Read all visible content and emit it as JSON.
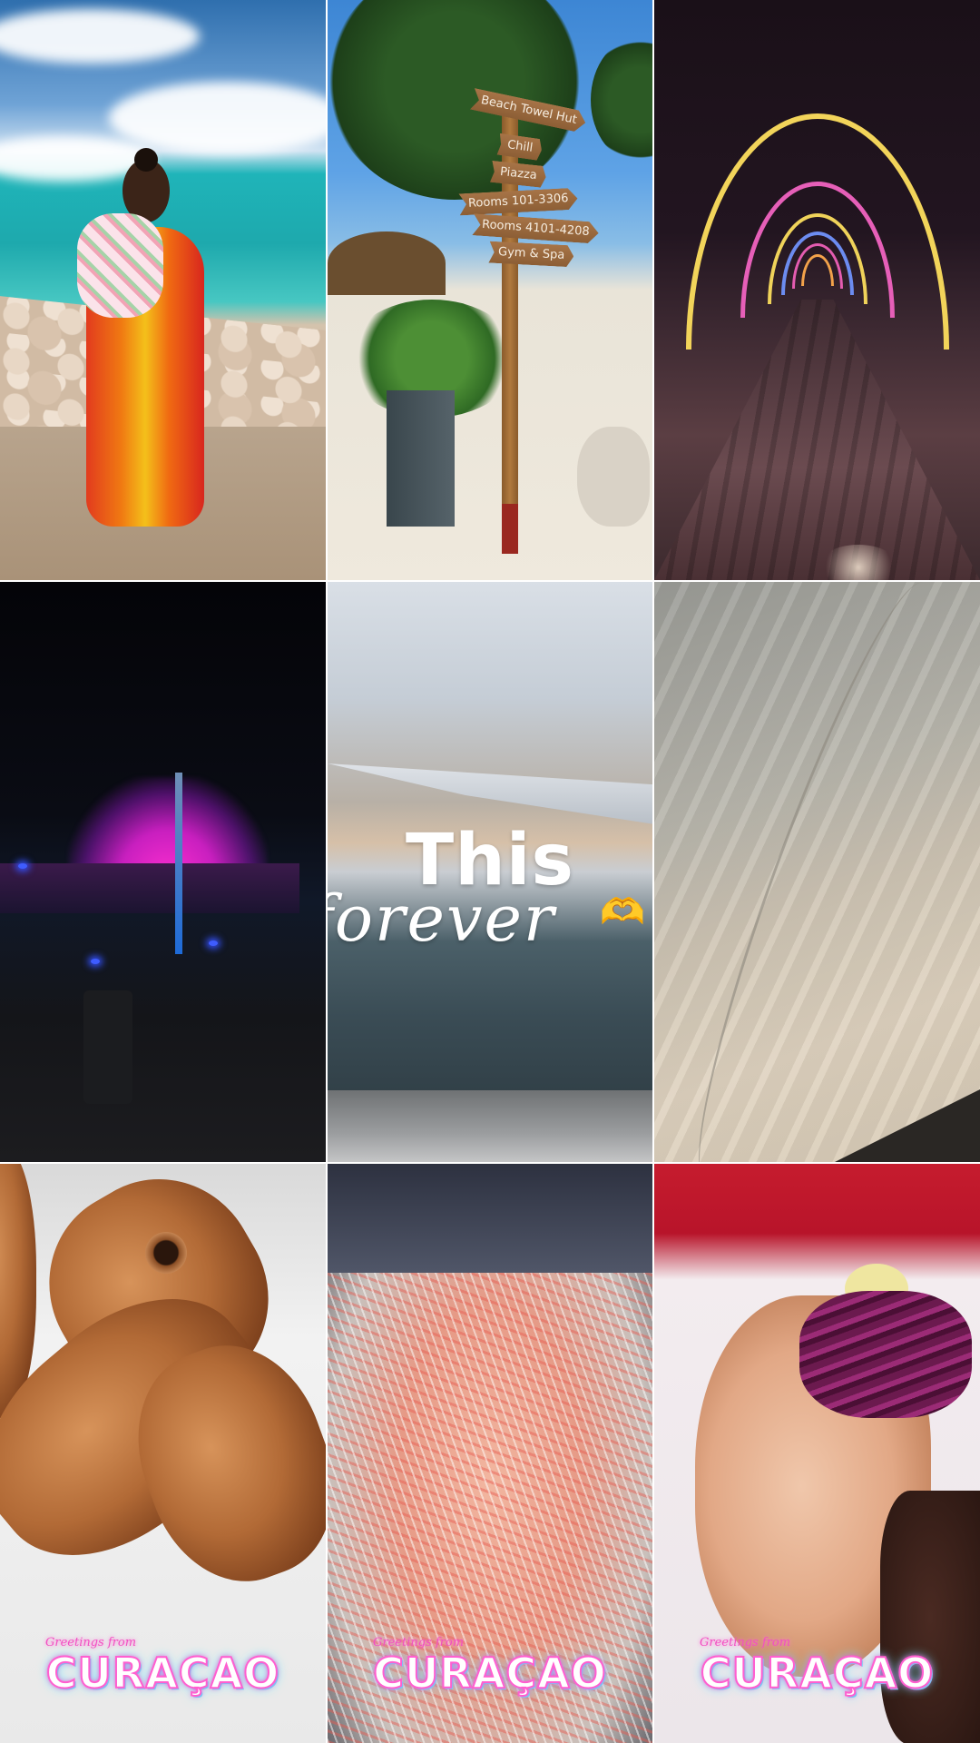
{
  "overlay": {
    "title": "This",
    "script": "forever",
    "emoji": "🫶"
  },
  "stickers": [
    {
      "greeting": "Greetings from",
      "place": "CURAÇAO"
    },
    {
      "greeting": "Greetings from",
      "place": "CURAÇAO"
    },
    {
      "greeting": "Greetings from",
      "place": "CURAÇAO"
    }
  ],
  "signpost": {
    "boards": [
      "Beach Towel Hut",
      "Chill",
      "Piazza",
      "Rooms 101-3306",
      "Rooms 4101-4208",
      "Gym & Spa"
    ]
  },
  "colors": {
    "overlay_text": "#ffffff",
    "sticker_pink": "#ff5fd0",
    "sticker_cyan": "#6fe6ff"
  }
}
